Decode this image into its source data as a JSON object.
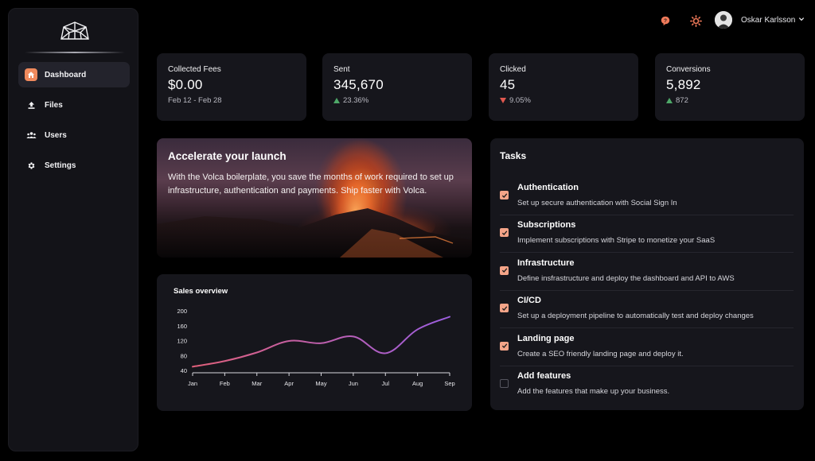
{
  "colors": {
    "accent": "#f08a5d",
    "bg": "#000000",
    "card": "#16161c",
    "positive": "#4ea868",
    "negative": "#e0584f",
    "line_start": "#e0607a",
    "line_end": "#9c5ee0"
  },
  "sidebar": {
    "logo": "volca-logo-icon",
    "items": [
      {
        "label": "Dashboard",
        "icon": "home-icon",
        "active": true
      },
      {
        "label": "Files",
        "icon": "upload-icon",
        "active": false
      },
      {
        "label": "Users",
        "icon": "users-icon",
        "active": false
      },
      {
        "label": "Settings",
        "icon": "gear-icon",
        "active": false
      }
    ]
  },
  "header": {
    "help_icon": "help-icon",
    "theme_icon": "sun-icon",
    "user_name": "Oskar Karlsson"
  },
  "stats": [
    {
      "title": "Collected Fees",
      "value": "$0.00",
      "sub": "Feb 12 - Feb 28",
      "trend": "none"
    },
    {
      "title": "Sent",
      "value": "345,670",
      "sub": "23.36%",
      "trend": "up"
    },
    {
      "title": "Clicked",
      "value": "45",
      "sub": "9.05%",
      "trend": "down"
    },
    {
      "title": "Conversions",
      "value": "5,892",
      "sub": "872",
      "trend": "up"
    }
  ],
  "hero": {
    "title": "Accelerate your launch",
    "text": "With the Volca boilerplate, you save the months of work required to set up infrastructure, authentication and payments. Ship faster with Volca."
  },
  "chart_data": {
    "type": "line",
    "title": "Sales overview",
    "categories": [
      "Jan",
      "Feb",
      "Mar",
      "Apr",
      "May",
      "Jun",
      "Jul",
      "Aug",
      "Sep"
    ],
    "values": [
      50,
      65,
      88,
      119,
      113,
      131,
      86,
      150,
      184
    ],
    "ylim": [
      40,
      200
    ],
    "yticks": [
      40,
      80,
      120,
      160,
      200
    ],
    "grid": false
  },
  "tasks": {
    "title": "Tasks",
    "items": [
      {
        "title": "Authentication",
        "desc": "Set up secure authentication with Social Sign In",
        "done": true
      },
      {
        "title": "Subscriptions",
        "desc": "Implement subscriptions with Stripe to monetize your SaaS",
        "done": true
      },
      {
        "title": "Infrastructure",
        "desc": "Define insfrastructure and deploy the dashboard and API to AWS",
        "done": true
      },
      {
        "title": "CI/CD",
        "desc": "Set up a deployment pipeline to automatically test and deploy changes",
        "done": true
      },
      {
        "title": "Landing page",
        "desc": "Create a SEO friendly landing page and deploy it.",
        "done": true
      },
      {
        "title": "Add features",
        "desc": "Add the features that make up your business.",
        "done": false
      }
    ]
  }
}
